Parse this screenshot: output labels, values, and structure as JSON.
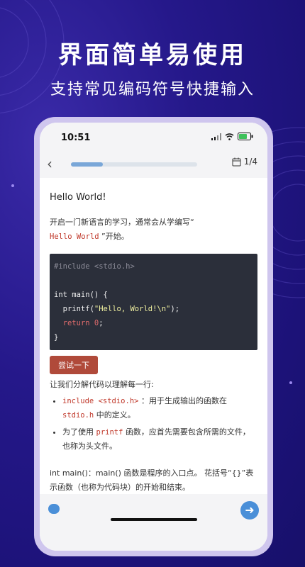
{
  "promo": {
    "headline": "界面简单易使用",
    "subline": "支持常见编码符号快捷输入"
  },
  "status_bar": {
    "time": "10:51"
  },
  "nav": {
    "progress": 0.25,
    "page_counter": "1/4"
  },
  "lesson": {
    "title": "Hello World!",
    "intro_prefix": "开启一门新语言的学习，通常会从学编写“",
    "intro_code": "Hello World",
    "intro_suffix": "”开始。",
    "code_lines": {
      "line1": "#include <stdio.h>",
      "line3_prefix": "int main() {",
      "line4_prefix": "  printf(",
      "line4_string": "\"Hello, World!\\n\"",
      "line4_suffix": ");",
      "line5_keyword": "  return",
      "line5_number": " 0",
      "line5_suffix": ";",
      "line6": "}"
    },
    "try_button": "尝试一下",
    "explain": "让我们分解代码以理解每一行:",
    "points": [
      {
        "code": "include <stdio.h>",
        "text_a": "：用于生成输出的函数在",
        "code_b": "stdio.h",
        "text_b": "中的定义。"
      },
      {
        "text_pre": "为了使用",
        "code": "printf",
        "text_post": "函数，应首先需要包含所需的文件，也称为头文件。"
      }
    ],
    "main_explain": "int main()：main() 函数是程序的入口点。 花括号“{}”表示函数（也称为代码块）的开始和结束。"
  },
  "icons": {
    "back": "chevron-left-icon",
    "calendar": "calendar-icon",
    "chat": "chat-icon",
    "send": "arrow-right-icon"
  },
  "colors": {
    "background": "#1c1278",
    "accent": "#4a8fd8",
    "try_button": "#b04a3a",
    "code_bg": "#2b2f3a"
  }
}
